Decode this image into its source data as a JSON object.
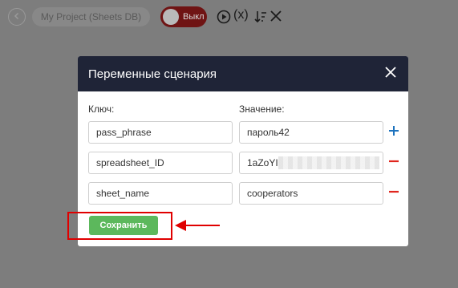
{
  "toolbar": {
    "project_name": "My Project (Sheets DB)",
    "toggle_label": "Выкл",
    "icons": [
      "back-icon",
      "play-icon",
      "variables-icon",
      "sort-icon",
      "close-icon"
    ],
    "variables_label": "(x)"
  },
  "modal": {
    "title": "Переменные сценария",
    "key_header": "Ключ:",
    "value_header": "Значение:",
    "rows": [
      {
        "key": "pass_phrase",
        "value": "пароль42",
        "action": "add"
      },
      {
        "key": "spreadsheet_ID",
        "value": "1aZoYI",
        "value_blurred": true,
        "action": "remove"
      },
      {
        "key": "sheet_name",
        "value": "cooperators",
        "action": "remove"
      }
    ],
    "save_label": "Сохранить"
  },
  "colors": {
    "header_bg": "#1f2437",
    "save_green": "#5cb85c",
    "add_blue": "#1e73be",
    "remove_red": "#e0261e",
    "annotation_red": "#e00000",
    "toggle_bg": "#6f1414"
  }
}
